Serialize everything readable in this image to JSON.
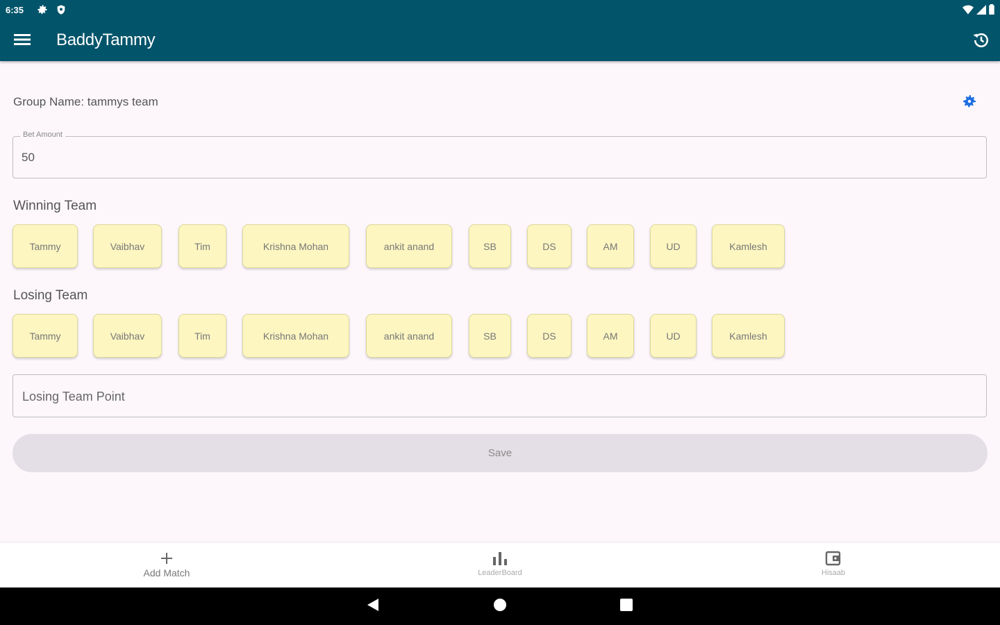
{
  "status_bar": {
    "time": "6:35"
  },
  "app_bar": {
    "title": "BaddyTammy"
  },
  "group": {
    "label": "Group Name: tammys team"
  },
  "bet": {
    "label": "Bet Amount",
    "value": "50"
  },
  "winning_team": {
    "title": "Winning Team",
    "players": [
      "Tammy",
      "Vaibhav",
      "Tim",
      "Krishna Mohan",
      "ankit anand",
      "SB",
      "DS",
      "AM",
      "UD",
      "Kamlesh"
    ]
  },
  "losing_team": {
    "title": "Losing Team",
    "players": [
      "Tammy",
      "Vaibhav",
      "Tim",
      "Krishna Mohan",
      "ankit anand",
      "SB",
      "DS",
      "AM",
      "UD",
      "Kamlesh"
    ]
  },
  "points": {
    "placeholder": "Losing Team Point",
    "value": ""
  },
  "save": {
    "label": "Save"
  },
  "bottom_nav": {
    "items": [
      {
        "label": "Add Match",
        "icon": "plus-icon"
      },
      {
        "label": "LeaderBoard",
        "icon": "bar-chart-icon"
      },
      {
        "label": "Hisaab",
        "icon": "wallet-icon"
      }
    ]
  },
  "colors": {
    "app_bar": "#02546a",
    "chip_fill": "#fdf6c1",
    "accent_gear": "#1e6fe0",
    "background": "#fdf7fc"
  }
}
